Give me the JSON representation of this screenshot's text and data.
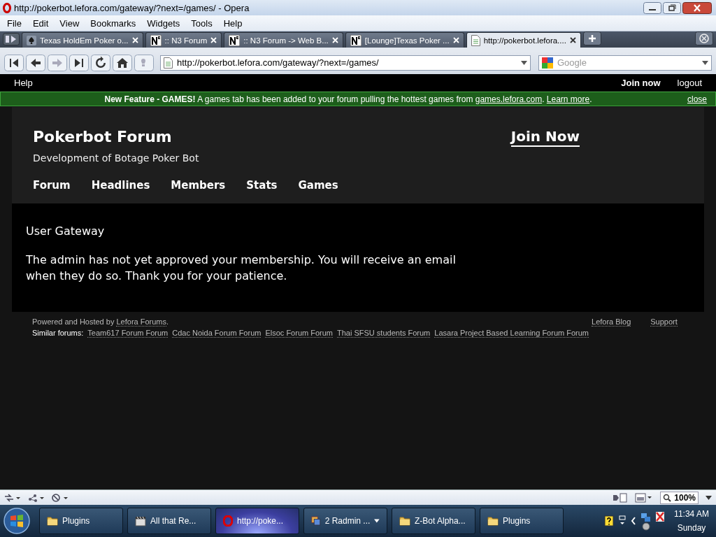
{
  "window": {
    "title": "http://pokerbot.lefora.com/gateway/?next=/games/ - Opera"
  },
  "menu": [
    "File",
    "Edit",
    "View",
    "Bookmarks",
    "Widgets",
    "Tools",
    "Help"
  ],
  "tabs": [
    {
      "label": "Texas HoldEm Poker o...",
      "kind": "spade",
      "selected": false
    },
    {
      "label": ":: N3 Forum",
      "kind": "n3",
      "selected": false
    },
    {
      "label": ":: N3 Forum -> Web B...",
      "kind": "n3",
      "selected": false
    },
    {
      "label": "[Lounge]Texas Poker ...",
      "kind": "n3",
      "selected": false
    },
    {
      "label": "http://pokerbot.lefora....",
      "kind": "page",
      "selected": true
    }
  ],
  "toolbar": {
    "address": "http://pokerbot.lefora.com/gateway/?next=/games/",
    "search": {
      "placeholder": "Google"
    }
  },
  "site_bar": {
    "help": "Help",
    "join": "Join now",
    "logout": "logout"
  },
  "banner": {
    "message": [
      {
        "kind": "text",
        "text": "**New Feature - GAMES!** A games tab has been added to your forum pulling the hottest games from "
      },
      {
        "kind": "link",
        "text": "games.lefora.com"
      },
      {
        "kind": "text",
        "text": ". "
      },
      {
        "kind": "link",
        "text": "Learn more"
      },
      {
        "kind": "text",
        "text": "."
      }
    ],
    "close": "close"
  },
  "forum": {
    "title": "Pokerbot Forum",
    "subtitle": "Development of Botage Poker Bot",
    "join": "Join Now",
    "nav": [
      "Forum",
      "Headlines",
      "Members",
      "Stats",
      "Games"
    ]
  },
  "content": {
    "heading": "User Gateway",
    "message": "The admin has not yet approved your membership. You will receive an email when they do so. Thank you for your patience."
  },
  "footer": {
    "powered": [
      {
        "kind": "text",
        "text": "Powered and Hosted by "
      },
      {
        "kind": "link",
        "text": "Lefora Forums"
      },
      {
        "kind": "text",
        "text": "."
      }
    ],
    "similar_label": "Similar forums:",
    "similar": [
      "Team617 Forum Forum",
      "Cdac Noida Forum Forum",
      "Elsoc Forum Forum",
      "Thai SFSU students Forum",
      "Lasara Project Based Learning Forum Forum"
    ],
    "links": [
      "Lefora Blog",
      "Support"
    ]
  },
  "status_bar": {
    "zoom": "100%"
  },
  "taskbar": {
    "items": [
      {
        "label": "Plugins",
        "kind": "folder",
        "selected": false
      },
      {
        "label": "All that Re...",
        "kind": "film",
        "selected": false
      },
      {
        "label": "http://poke...",
        "kind": "opera",
        "selected": true
      },
      {
        "label": "2 Radmin ...",
        "kind": "group",
        "selected": false
      },
      {
        "label": "Z-Bot Alpha...",
        "kind": "folder",
        "selected": false
      },
      {
        "label": "Plugins",
        "kind": "folder",
        "selected": false
      }
    ],
    "time": "11:34 AM",
    "day": "Sunday"
  }
}
